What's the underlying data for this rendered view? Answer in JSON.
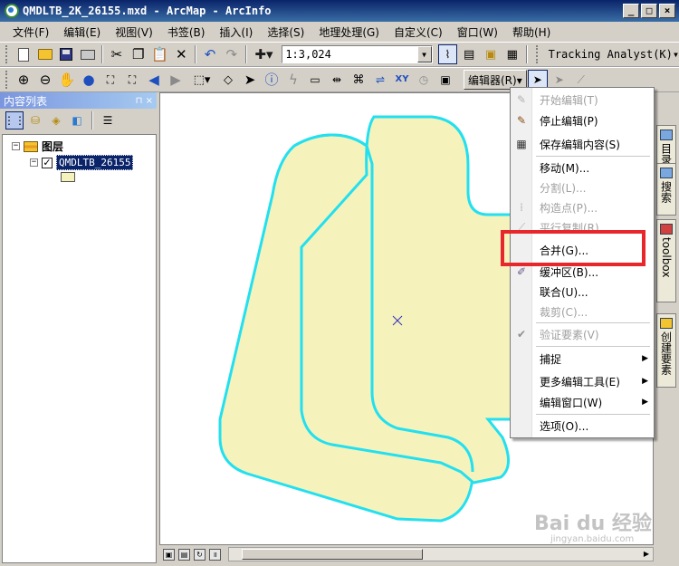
{
  "window": {
    "title": "QMDLTB_2K_26155.mxd - ArcMap - ArcInfo",
    "min": "_",
    "max": "□",
    "close": "×"
  },
  "menu": [
    "文件(F)",
    "编辑(E)",
    "视图(V)",
    "书签(B)",
    "插入(I)",
    "选择(S)",
    "地理处理(G)",
    "自定义(C)",
    "窗口(W)",
    "帮助(H)"
  ],
  "toolbar": {
    "scale": "1:3,024",
    "tracking": "Tracking Analyst(K)▾",
    "editor": "编辑器(R)▾"
  },
  "toc": {
    "title": "内容列表",
    "group": "图层",
    "layer": "QMDLTB_26155",
    "expand_group": "−",
    "expand_layer": "−",
    "check": "✓"
  },
  "rdock": {
    "tab1": "目录",
    "tab2": "搜索",
    "tab3": "toolbox",
    "tab4": "创建要素"
  },
  "editor_menu": [
    {
      "label": "开始编辑(T)",
      "disabled": true,
      "icon": "pencil-icon"
    },
    {
      "label": "停止编辑(P)",
      "disabled": false,
      "icon": "pencil-icon"
    },
    {
      "label": "保存编辑内容(S)",
      "disabled": false,
      "icon": "save-icon"
    },
    {
      "label": "移动(M)...",
      "disabled": false
    },
    {
      "label": "分割(L)...",
      "disabled": true
    },
    {
      "label": "构造点(P)...",
      "disabled": true,
      "icon": "points-icon"
    },
    {
      "label": "平行复制(R)...",
      "disabled": true
    },
    {
      "label": "合并(G)...",
      "disabled": false
    },
    {
      "label": "缓冲区(B)...",
      "disabled": false,
      "icon": "buffer-icon"
    },
    {
      "label": "联合(U)...",
      "disabled": false
    },
    {
      "label": "裁剪(C)...",
      "disabled": true
    },
    {
      "label": "验证要素(V)",
      "disabled": true,
      "icon": "validate-icon"
    },
    {
      "label": "捕捉",
      "disabled": false,
      "submenu": true
    },
    {
      "label": "更多编辑工具(E)",
      "disabled": false,
      "submenu": true
    },
    {
      "label": "编辑窗口(W)",
      "disabled": false,
      "submenu": true
    },
    {
      "label": "选项(O)...",
      "disabled": false
    }
  ],
  "watermark": {
    "main": "Bai du 经验",
    "sub": "jingyan.baidu.com"
  },
  "colors": {
    "polygon_fill": "#f6f2bc",
    "polygon_outline": "#22e0f0",
    "highlight": "#e8272c",
    "title_bar": "#0a246a"
  }
}
